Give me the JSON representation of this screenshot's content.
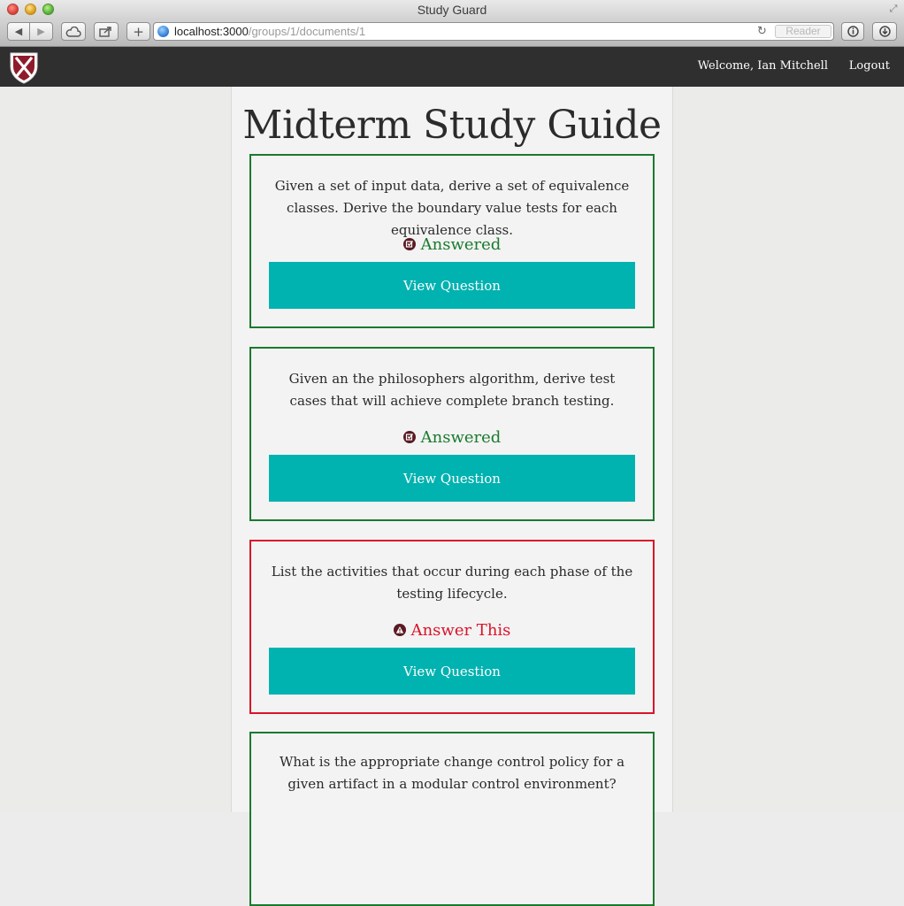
{
  "browser": {
    "window_title": "Study Guard",
    "url_host": "localhost:3000",
    "url_path": "/groups/1/documents/1",
    "reader_label": "Reader"
  },
  "header": {
    "welcome": "Welcome, Ian Mitchell",
    "logout": "Logout"
  },
  "page": {
    "title": "Midterm Study Guide"
  },
  "questions": [
    {
      "text": "Given a set of input data, derive a set of equivalence classes. Derive the boundary value tests for each equivalence class.",
      "status": "Answered",
      "button": "View Question"
    },
    {
      "text": "Given an the philosophers algorithm, derive test cases that will achieve complete branch testing.",
      "status": "Answered",
      "button": "View Question"
    },
    {
      "text": "List the activities that occur during each phase of the testing lifecycle.",
      "status": "Answer This",
      "button": "View Question"
    },
    {
      "text": "What is the appropriate change control policy for a given artifact in a modular control environment?",
      "status": "",
      "button": ""
    }
  ],
  "colors": {
    "answered": "#1a7a2e",
    "unanswered": "#d9142a",
    "button": "#00b2b0",
    "header": "#2f2f2f"
  }
}
